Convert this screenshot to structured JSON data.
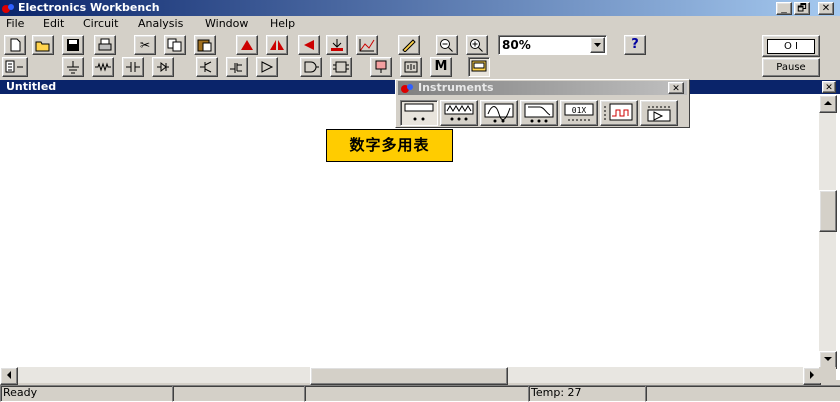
{
  "window": {
    "title": "Electronics Workbench",
    "min_label": "_",
    "max_label": "🗗",
    "close_label": "✕"
  },
  "menu": [
    "File",
    "Edit",
    "Circuit",
    "Analysis",
    "Window",
    "Help"
  ],
  "toolbar": {
    "zoom_value": "80%",
    "help_label": "?",
    "pause_label": "Pause",
    "power_label": "O I",
    "meter_label": "M"
  },
  "document": {
    "title": "Untitled",
    "close_label": "✕"
  },
  "instruments": {
    "title": "Instruments",
    "close_label": "✕",
    "tooltip": "数字多用表"
  },
  "status": {
    "ready": "Ready",
    "temp": "Temp:  27"
  },
  "colors": {
    "titlebar": "#0a246a",
    "tooltip_bg": "#ffcc00",
    "face": "#d4d0c8"
  }
}
